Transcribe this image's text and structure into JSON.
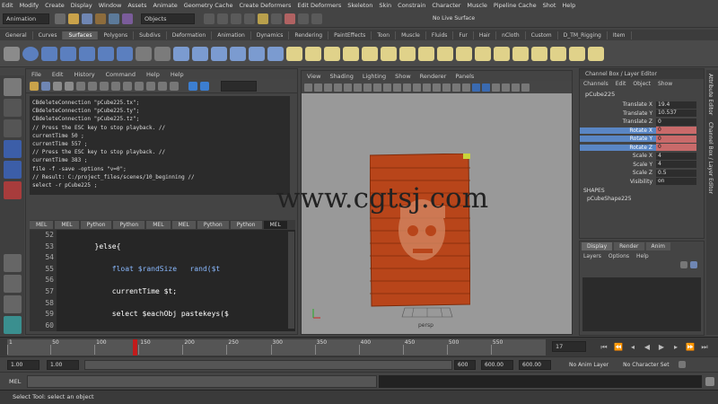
{
  "menubar": [
    "Edit",
    "Modify",
    "Create",
    "Display",
    "Window",
    "Assets",
    "Animate",
    "Geometry Cache",
    "Create Deformers",
    "Edit Deformers",
    "Skeleton",
    "Skin",
    "Constrain",
    "Character",
    "Muscle",
    "Pipeline Cache",
    "Shot",
    "Help"
  ],
  "status": {
    "mode": "Animation",
    "object_field": "Objects",
    "live": "No Live Surface"
  },
  "shelf_tabs": [
    "General",
    "Curves",
    "Surfaces",
    "Polygons",
    "Subdivs",
    "Deformation",
    "Animation",
    "Dynamics",
    "Rendering",
    "PaintEffects",
    "Toon",
    "Muscle",
    "Fluids",
    "Fur",
    "Hair",
    "nCloth",
    "Custom",
    "D_TM_Rigging",
    "Item"
  ],
  "shelf_active": "Surfaces",
  "script_editor": {
    "menu": [
      "File",
      "Edit",
      "History",
      "Command",
      "Help",
      "Help"
    ],
    "history_lines": [
      "CBdeleteConnection \"pCube225.tx\";",
      "CBdeleteConnection \"pCube225.ty\";",
      "CBdeleteConnection \"pCube225.tz\";",
      "// Press the ESC key to stop playback. //",
      "currentTime 50 ;",
      "currentTime 557 ;",
      "// Press the ESC key to stop playback. //",
      "currentTime 383 ;",
      "file -f -save -options \"v=0\";",
      "// Result: C:/project_files/scenes/10_beginning //",
      "select -r pCube225 ;"
    ],
    "tabs": [
      "MEL",
      "MEL",
      "Python",
      "Python",
      "MEL",
      "MEL",
      "Python",
      "Python",
      "MEL"
    ],
    "active_tab": 8,
    "line_numbers": [
      "52",
      "53",
      "54",
      "55",
      "56",
      "57",
      "58",
      "59",
      "60"
    ],
    "code_lines": [
      {
        "text": "",
        "cls": ""
      },
      {
        "text": "        }else{",
        "cls": ""
      },
      {
        "text": "",
        "cls": ""
      },
      {
        "text": "            float $randSize   rand($t",
        "cls": "kw"
      },
      {
        "text": "",
        "cls": ""
      },
      {
        "text": "            currentTime $t;",
        "cls": ""
      },
      {
        "text": "",
        "cls": ""
      },
      {
        "text": "            select $eachObj pastekeys($",
        "cls": ""
      },
      {
        "text": "",
        "cls": ""
      }
    ]
  },
  "viewport": {
    "menu": [
      "View",
      "Shading",
      "Lighting",
      "Show",
      "Renderer",
      "Panels"
    ],
    "watermark": "www.cgtsj.com",
    "camera": "persp"
  },
  "channel_box": {
    "header": "Channel Box / Layer Editor",
    "menu": [
      "Channels",
      "Edit",
      "Object",
      "Show"
    ],
    "object": "pCube225",
    "attributes": [
      {
        "name": "Translate X",
        "value": "19.4",
        "hl": false
      },
      {
        "name": "Translate Y",
        "value": "10.537",
        "hl": false
      },
      {
        "name": "Translate Z",
        "value": "0",
        "hl": false
      },
      {
        "name": "Rotate X",
        "value": "0",
        "hl": true
      },
      {
        "name": "Rotate Y",
        "value": "0",
        "hl": true
      },
      {
        "name": "Rotate Z",
        "value": "0",
        "hl": true
      },
      {
        "name": "Scale X",
        "value": "4",
        "hl": false
      },
      {
        "name": "Scale Y",
        "value": "4",
        "hl": false
      },
      {
        "name": "Scale Z",
        "value": "0.5",
        "hl": false
      },
      {
        "name": "Visibility",
        "value": "on",
        "hl": false
      }
    ],
    "shapes_label": "SHAPES",
    "shape_name": "pCubeShape225"
  },
  "layers": {
    "tabs": [
      "Display",
      "Render",
      "Anim"
    ],
    "menu": [
      "Layers",
      "Options",
      "Help"
    ]
  },
  "side_tabs": [
    "Attribute Editor",
    "Channel Box / Layer Editor"
  ],
  "timeline": {
    "ticks": [
      "1",
      "50",
      "100",
      "150",
      "200",
      "250",
      "300",
      "350",
      "400",
      "450",
      "500",
      "550"
    ],
    "current_frame": "17"
  },
  "range": {
    "start": "1.00",
    "start2": "1.00",
    "end1": "600",
    "end2": "600.00",
    "end3": "600.00",
    "anim_layer": "No Anim Layer",
    "character": "No Character Set"
  },
  "cmd": {
    "label": "MEL"
  },
  "help_line": "Select Tool: select an object"
}
